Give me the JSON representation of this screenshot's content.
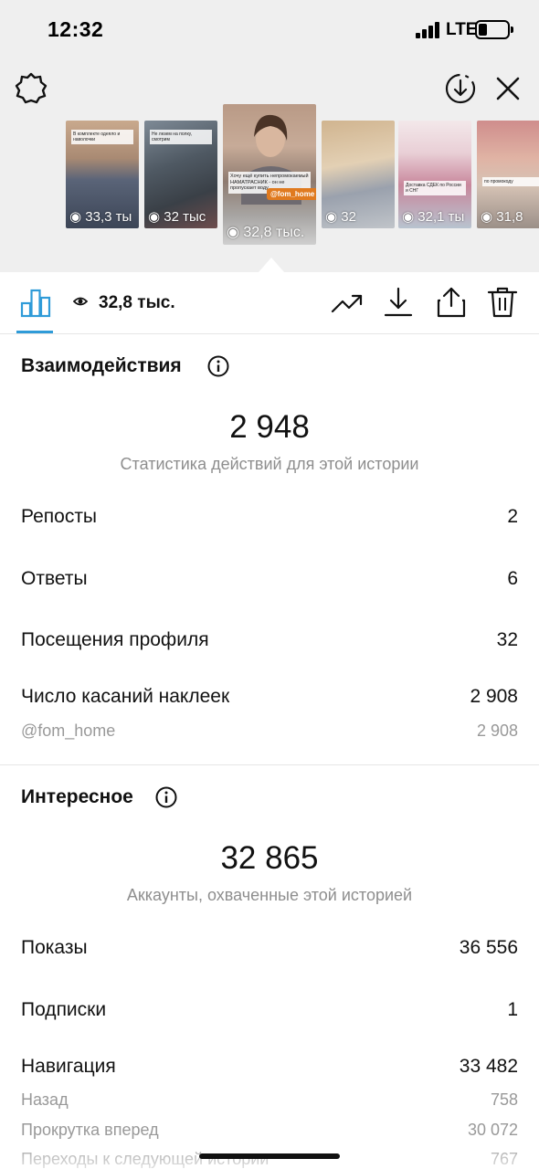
{
  "status_bar": {
    "time": "12:32",
    "network": "LTE"
  },
  "stories": [
    {
      "views": "33,3 ты",
      "caption": "В комплекте одеяло и наволочки",
      "tag": ""
    },
    {
      "views": "32 тыс",
      "caption": "Не лезем на полку, смотрим",
      "tag": ""
    },
    {
      "views": "32,8 тыс.",
      "caption": "Хочу ещё купить непромокаемый НАМАТРАСНИК - он не пропускает воду",
      "tag": "@fom_home",
      "selected": true
    },
    {
      "views": "32",
      "caption": "",
      "tag": ""
    },
    {
      "views": "32,1 ты",
      "caption": "Доставка СДЕК по России и СНГ",
      "tag": ""
    },
    {
      "views": "31,8",
      "caption": "по промокоду",
      "tag": ""
    }
  ],
  "toolbar": {
    "views": "32,8 тыс.",
    "icons": [
      "bar-chart-icon",
      "eye-icon",
      "trending-icon",
      "download-icon",
      "share-icon",
      "trash-icon"
    ]
  },
  "interactions": {
    "title": "Взаимодействия",
    "total": "2 948",
    "subtitle": "Статистика действий для этой истории",
    "rows": [
      {
        "label": "Репосты",
        "value": "2"
      },
      {
        "label": "Ответы",
        "value": "6"
      },
      {
        "label": "Посещения профиля",
        "value": "32"
      },
      {
        "label": "Число касаний наклеек",
        "value": "2 908"
      }
    ],
    "sub_rows": [
      {
        "label": "@fom_home",
        "value": "2 908"
      }
    ]
  },
  "discovery": {
    "title": "Интересное",
    "total": "32 865",
    "subtitle": "Аккаунты, охваченные этой историей",
    "rows": [
      {
        "label": "Показы",
        "value": "36 556"
      },
      {
        "label": "Подписки",
        "value": "1"
      },
      {
        "label": "Навигация",
        "value": "33 482"
      }
    ],
    "sub_rows": [
      {
        "label": "Назад",
        "value": "758"
      },
      {
        "label": "Прокрутка вперед",
        "value": "30 072"
      },
      {
        "label": "Переходы к следующей истории",
        "value": "767"
      }
    ]
  },
  "colors": {
    "accent": "#2f9bd8",
    "tag": "#e07a1f"
  }
}
